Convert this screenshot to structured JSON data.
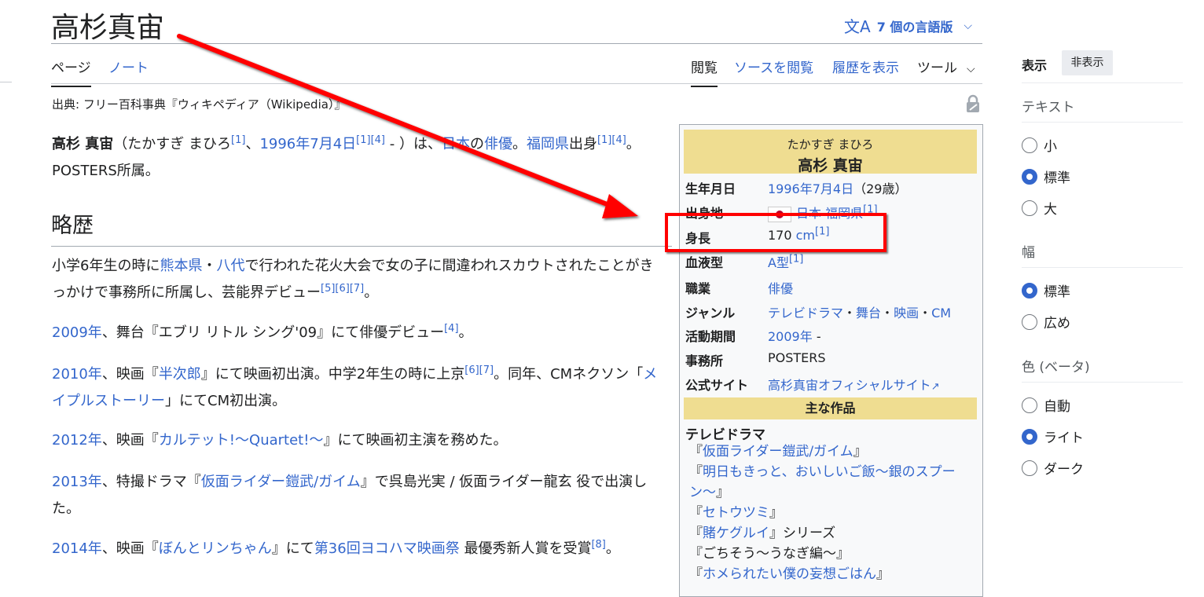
{
  "page": {
    "title": "高杉真宙",
    "language_button": "7 個の言語版",
    "tabs": {
      "page": "ページ",
      "talk": "ノート",
      "read": "閲覧",
      "view_source": "ソースを閲覧",
      "history": "履歴を表示",
      "tools": "ツール"
    },
    "source_note": "出典: フリー百科事典『ウィキペディア（Wikipedia）』"
  },
  "article": {
    "intro": {
      "name": "高杉 真宙",
      "reading": "（たかすぎ まひろ",
      "ref1": "[1]",
      "sep1": "、",
      "birth_link": "1996年7月4日",
      "refs_birth": "[1][4]",
      "mid": " - ）は、",
      "japan": "日本",
      "no": "の",
      "actor": "俳優",
      "dot": "。",
      "fukuoka": "福岡県",
      "shusshin": "出身",
      "refs_end": "[1][4]",
      "posters": "。POSTERS所属。"
    },
    "heading": "略歴",
    "p1": {
      "a": "小学6年生の時に",
      "kumamoto": "熊本県",
      "b": "・",
      "yatsushiro": "八代",
      "c": "で行われた花火大会で女の子に間違われスカウトされたことがきっかけで事務所に所属し、芸能界デビュー",
      "refs": "[5][6][7]",
      "d": "。"
    },
    "p2": {
      "year": "2009年",
      "a": "、舞台『エブリ リトル シング'09』にて俳優デビュー",
      "ref": "[4]",
      "b": "。"
    },
    "p3": {
      "year": "2010年",
      "a": "、映画『",
      "film": "半次郎",
      "b": "』にて映画初出演。中学2年生の時に上京",
      "refs": "[6][7]",
      "c": "。同年、CMネクソン「",
      "cm": "メイプルストーリー",
      "d": "」にてCM初出演。"
    },
    "p4": {
      "year": "2012年",
      "a": "、映画『",
      "film": "カルテット!〜Quartet!〜",
      "b": "』にて映画初主演を務めた。"
    },
    "p5": {
      "year": "2013年",
      "a": "、特撮ドラマ『",
      "drama": "仮面ライダー鎧武/ガイム",
      "b": "』で呉島光実 / 仮面ライダー龍玄 役で出演した。"
    },
    "p6": {
      "year": "2014年",
      "a": "、映画『",
      "film": "ぼんとリンちゃん",
      "b": "』にて",
      "award": "第36回ヨコハマ映画祭",
      "c": " 最優秀新人賞を受賞",
      "ref": "[8]",
      "d": "。"
    }
  },
  "infobox": {
    "kana": "たかすぎ まひろ",
    "name": "高杉 真宙",
    "rows": {
      "birth": {
        "label": "生年月日",
        "link": "1996年7月4日",
        "extra": "（29歳）"
      },
      "birthplace": {
        "label": "出身地",
        "country": "日本",
        "pref": "福岡県",
        "ref": "[1]"
      },
      "height": {
        "label": "身長",
        "num": "170 ",
        "unit": "cm",
        "ref": "[1]"
      },
      "blood": {
        "label": "血液型",
        "value": "A型",
        "ref": "[1]"
      },
      "job": {
        "label": "職業",
        "value": "俳優"
      },
      "genre": {
        "label": "ジャンル",
        "tv": "テレビドラマ",
        "stage": "舞台",
        "film": "映画",
        "cm": "CM",
        "sep": "・"
      },
      "active": {
        "label": "活動期間",
        "year": "2009年",
        "dash": " -"
      },
      "agency": {
        "label": "事務所",
        "value": "POSTERS"
      },
      "site": {
        "label": "公式サイト",
        "value": "高杉真宙オフィシャルサイト"
      }
    },
    "works_header": "主な作品",
    "works_title": "テレビドラマ",
    "works": [
      {
        "pre": "『",
        "title": "仮面ライダー鎧武/ガイム",
        "post": "』"
      },
      {
        "pre": "『",
        "title": "明日もきっと、おいしいご飯〜銀のスプーン〜",
        "post": "』"
      },
      {
        "pre": "『",
        "title": "セトウツミ",
        "post": "』"
      },
      {
        "pre": "『",
        "title": "賭ケグルイ",
        "post": "』シリーズ"
      },
      {
        "pre": "『ごちそう〜うなぎ編〜』",
        "title": "",
        "post": ""
      },
      {
        "pre": "『",
        "title": "ホメられたい僕の妄想ごはん",
        "post": "』"
      }
    ]
  },
  "sidebar": {
    "title": "表示",
    "hide": "非表示",
    "text_heading": "テキスト",
    "text_options": [
      "小",
      "標準",
      "大"
    ],
    "width_heading": "幅",
    "width_options": [
      "標準",
      "広め"
    ],
    "color_heading": "色 (ベータ)",
    "color_options": [
      "自動",
      "ライト",
      "ダーク"
    ],
    "selected": {
      "text": "標準",
      "width": "標準",
      "color": "ライト"
    }
  },
  "colors": {
    "link": "#3366cc",
    "infobox_header": "#efdd91",
    "annotation": "#ff0000"
  },
  "icons": {
    "lang": "translate-icon",
    "lock": "lock-icon",
    "external": "external-link-icon"
  }
}
